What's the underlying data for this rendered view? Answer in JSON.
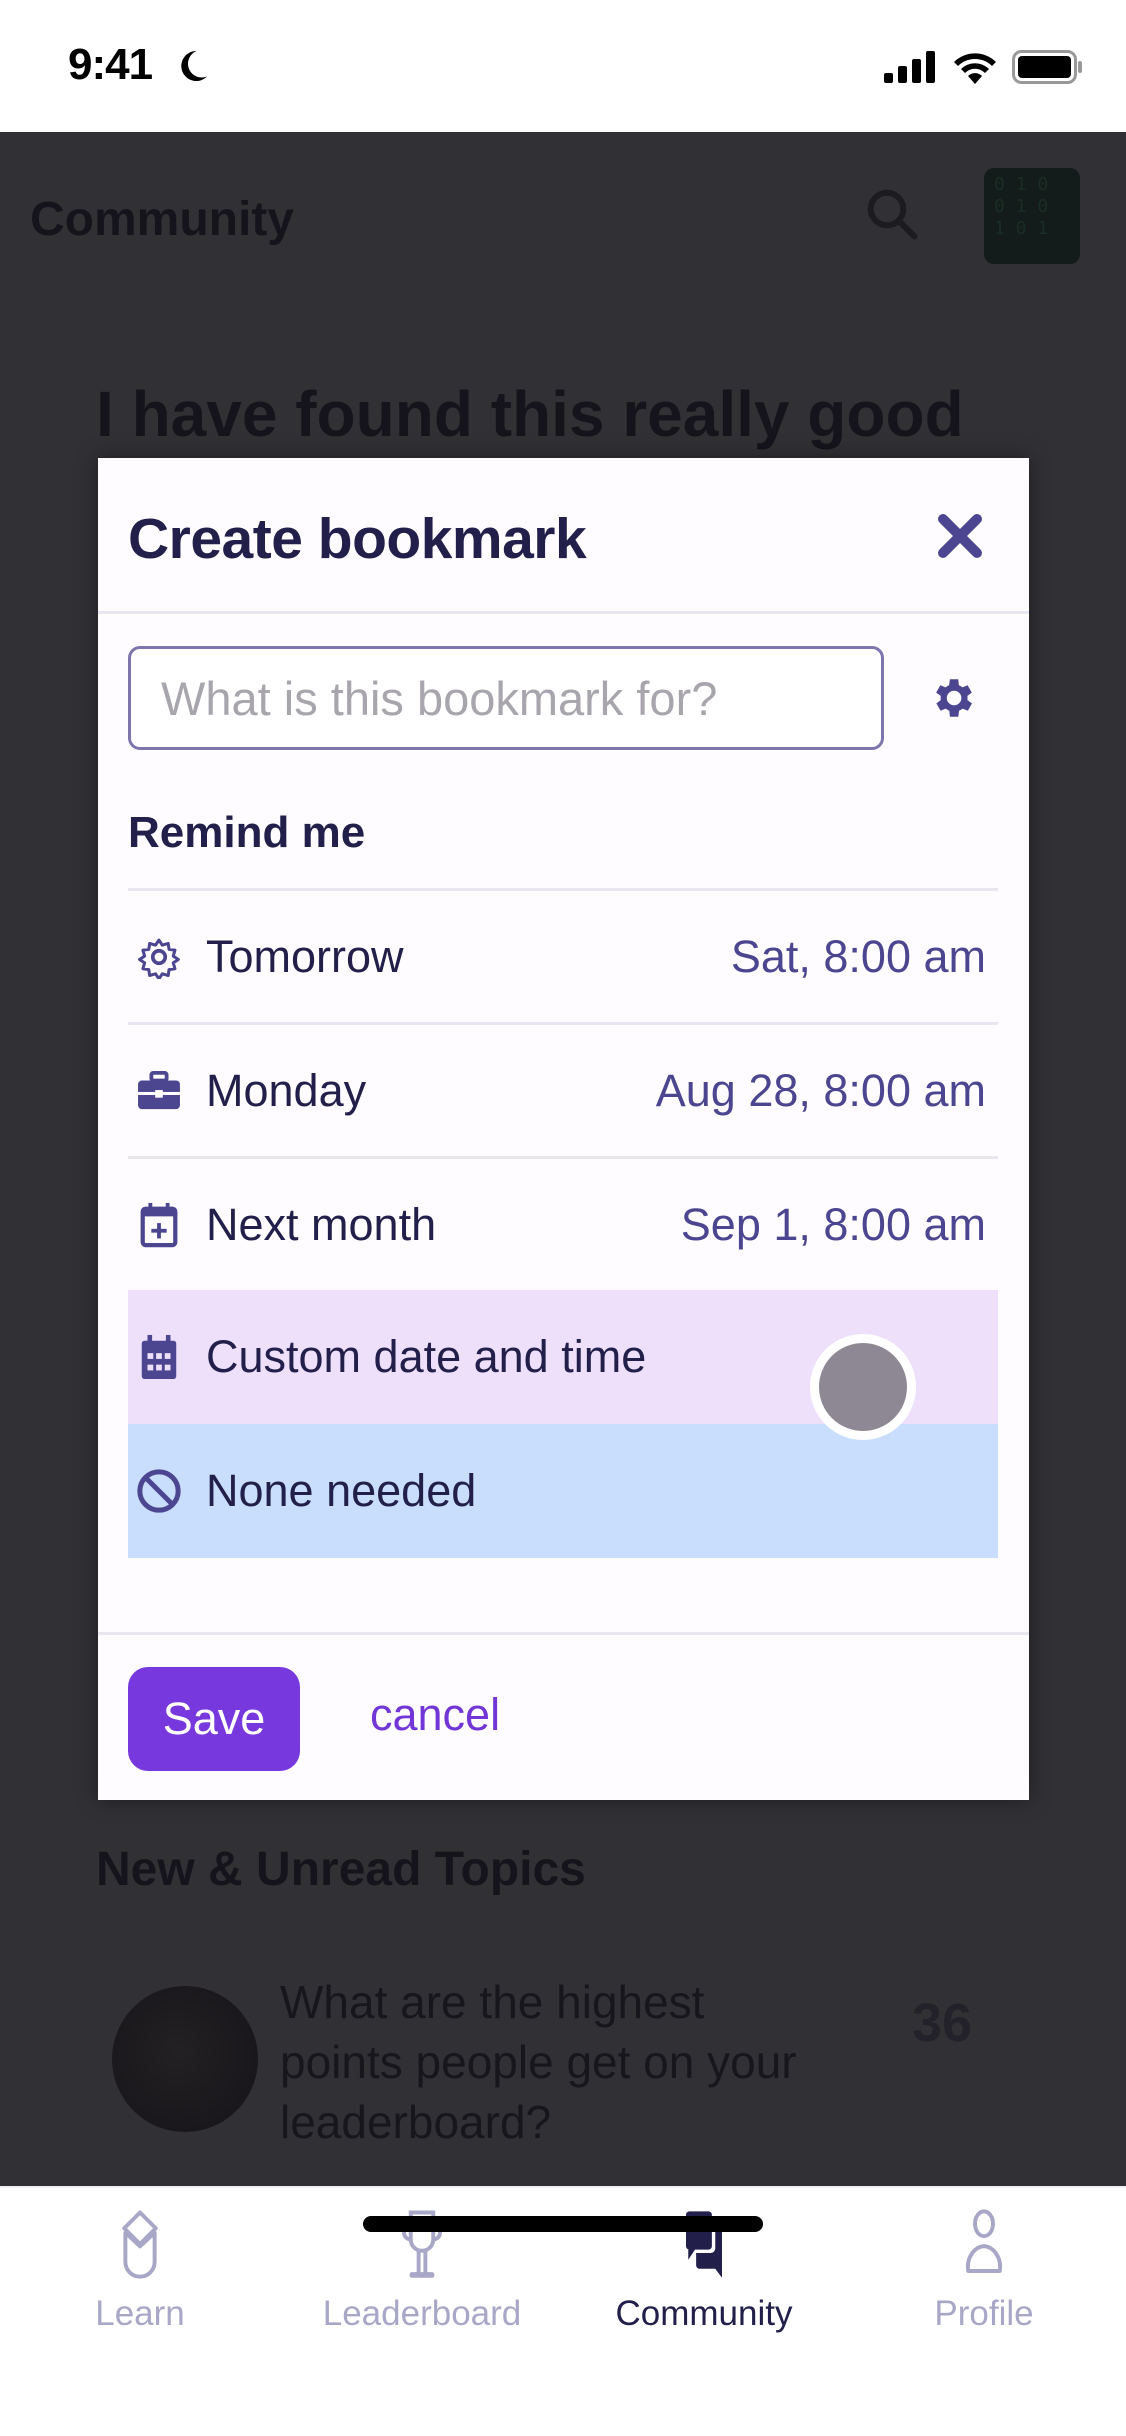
{
  "status_bar": {
    "time": "9:41",
    "focus_icon": "moon-icon",
    "signal_icon": "cellular-signal-icon",
    "wifi_icon": "wifi-icon",
    "battery_icon": "battery-icon"
  },
  "background": {
    "header_title": "Community",
    "avatar_text": "0 1 0\n0 1 0\n1 0 1",
    "topic_title": "I have found this really good",
    "section_title": "New & Unread Topics",
    "topic_row": {
      "text": "What are the highest points people get on your leaderboard?",
      "count": "36"
    }
  },
  "modal": {
    "title": "Create bookmark",
    "name_input": {
      "value": "",
      "placeholder": "What is this bookmark for?"
    },
    "remind_label": "Remind me",
    "options": [
      {
        "icon": "sun-icon",
        "label": "Tomorrow",
        "value": "Sat, 8:00 am"
      },
      {
        "icon": "briefcase-icon",
        "label": "Monday",
        "value": "Aug 28, 8:00 am"
      },
      {
        "icon": "calendar-plus-icon",
        "label": "Next month",
        "value": "Sep 1, 8:00 am"
      },
      {
        "icon": "calendar-icon",
        "label": "Custom date and time",
        "value": "",
        "state": "pressed"
      },
      {
        "icon": "ban-icon",
        "label": "None needed",
        "value": "",
        "state": "selected"
      }
    ],
    "save_label": "Save",
    "cancel_label": "cancel"
  },
  "tabs": [
    {
      "label": "Learn",
      "icon": "graduation-cap-icon",
      "active": false
    },
    {
      "label": "Leaderboard",
      "icon": "trophy-icon",
      "active": false
    },
    {
      "label": "Community",
      "icon": "chat-bubbles-icon",
      "active": true
    },
    {
      "label": "Profile",
      "icon": "user-icon",
      "active": false
    }
  ],
  "colors": {
    "accent": "#7739dd",
    "icon": "#4c4690",
    "text_dark": "#22204a",
    "pressed_row": "#eee0fb",
    "selected_row": "#c9ddfd",
    "tab_inactive": "#a9a7c7"
  }
}
